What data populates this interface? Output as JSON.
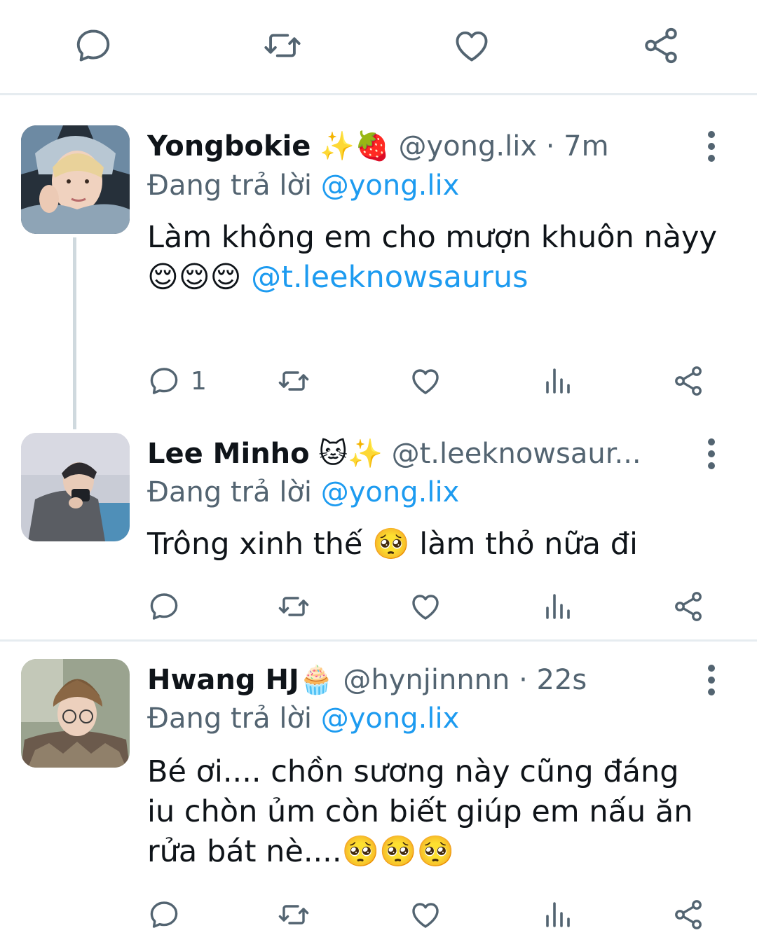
{
  "top_actions": {
    "icons": [
      "reply-icon",
      "retweet-icon",
      "like-icon",
      "share-icon"
    ],
    "color": "#536471"
  },
  "replying_prefix": "Đang trả lời",
  "tweets": [
    {
      "name": "Yongbokie",
      "name_emoji": "✨🍓",
      "handle": "@yong.lix",
      "sep": "·",
      "time": "7m",
      "replying_to": "@yong.lix",
      "text_1": "Làm không em cho mượn khuôn nàyy",
      "text_2_emoji": "😌😌😌",
      "text_2_mention": "@t.leeknowsaurus",
      "reply_count": "1"
    },
    {
      "name": "Lee Minho",
      "name_emoji": "🐱✨",
      "handle": "@t.leeknowsaur...",
      "replying_to": "@yong.lix",
      "text_before": "Trông xinh thế",
      "text_emoji": "🥺",
      "text_after": "làm thỏ nữa đi"
    },
    {
      "name": "Hwang HJ",
      "name_emoji": "🧁",
      "handle": "@hynjinnnn",
      "sep": "·",
      "time": "22s",
      "replying_to": "@yong.lix",
      "text_1": "Bé ơi.... chồn sương này cũng đáng iu chòn ủm còn biết giúp em nấu ăn rửa bát nè....",
      "text_emoji": "🥺🥺🥺"
    }
  ],
  "colors": {
    "text": "#0f1419",
    "secondary": "#536471",
    "link": "#1d9bf0",
    "divider": "#e6ecf0",
    "thread_line": "#cfd9de"
  }
}
